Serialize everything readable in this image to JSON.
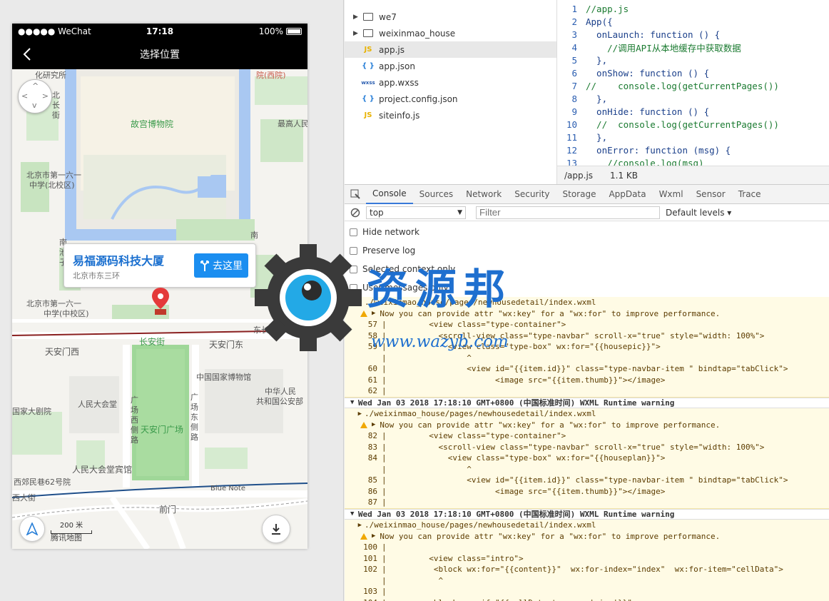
{
  "phone": {
    "carrier": "●●●●● WeChat",
    "time": "17:18",
    "battery": "100%",
    "nav_title": "选择位置"
  },
  "map": {
    "labels": {
      "research": "化研究所",
      "west_yuan": "院(西院)",
      "north_chang_1": "北",
      "north_chang_2": "长",
      "north_chang_3": "街",
      "palace": "故宫博物院",
      "supreme": "最高人民",
      "school1": "北京市第一六一",
      "school1b": "中学(北校区)",
      "nan1": "南",
      "nan2": "池",
      "nan2b": "子",
      "nan3": "南",
      "school2": "北京市第一六一",
      "school2b": "中学(中校区)",
      "east_chang": "东长安",
      "changan": "长安街",
      "tam_west": "天安门西",
      "tam_east": "天安门东",
      "museum": "中国国家博物馆",
      "guangchang_w1": "广",
      "guangchang_w2": "场",
      "guangchang_w3": "西",
      "guangchang_w4": "侧",
      "guangchang_w5": "路",
      "guangchang_e1": "广",
      "guangchang_e2": "场",
      "guangchang_e3": "东",
      "guangchang_e4": "侧",
      "guangchang_e5": "路",
      "people_hall": "人民大会堂",
      "security1": "中华人民",
      "security2": "共和国公安部",
      "theatre": "国家大剧院",
      "square": "天安门广场",
      "hall_hotel": "人民大会堂宾馆",
      "xijiao": "西郊民巷62号院",
      "blue_note": "Blue Note",
      "xidajie": "西大街",
      "qianmen": "前门",
      "scale": "200 米",
      "brand": "腾讯地图"
    },
    "popup": {
      "title": "易福源码科技大厦",
      "address": "北京市东三环",
      "go_label": "去这里"
    }
  },
  "file_tree": {
    "items": [
      {
        "name": "we7",
        "type": "folder"
      },
      {
        "name": "weixinmao_house",
        "type": "folder"
      },
      {
        "name": "app.js",
        "type": "js"
      },
      {
        "name": "app.json",
        "type": "json"
      },
      {
        "name": "app.wxss",
        "type": "wxss"
      },
      {
        "name": "project.config.json",
        "type": "json"
      },
      {
        "name": "siteinfo.js",
        "type": "js"
      }
    ]
  },
  "editor": {
    "lines": [
      "//app.js",
      "App({",
      "  onLaunch: function () {",
      "    //调用API从本地缓存中获取数据",
      "  },",
      "  onShow: function () {",
      "//    console.log(getCurrentPages())",
      "  },",
      "  onHide: function () {",
      "  //  console.log(getCurrentPages())",
      "  },",
      "  onError: function (msg) {",
      "    //console.log(msg)"
    ],
    "status_file": "/app.js",
    "status_size": "1.1 KB"
  },
  "devtools": {
    "tabs": [
      "Console",
      "Sources",
      "Network",
      "Security",
      "Storage",
      "AppData",
      "Wxml",
      "Sensor",
      "Trace"
    ],
    "context": "top",
    "filter_placeholder": "Filter",
    "levels": "Default levels",
    "options": [
      "Hide network",
      "Preserve log",
      "Selected context only",
      "User messages only"
    ]
  },
  "console": {
    "blocks": [
      {
        "header": "",
        "path": "./weixinmao_house/pages/newhousedetail/index.wxml",
        "message": "Now you can provide attr \"wx:key\" for a \"wx:for\" to improve performance.",
        "lines": [
          {
            "n": "57",
            "code": "        <view class=\"type-container\">"
          },
          {
            "n": "58",
            "code": "          <scroll-view class=\"type-navbar\" scroll-x=\"true\" style=\"width: 100%\">"
          },
          {
            "n": "59",
            "code": "            <view class=\"type-box\" wx:for=\"{{housepic}}\">",
            "mark": ">"
          },
          {
            "n": "",
            "code": "                ^"
          },
          {
            "n": "60",
            "code": "                <view id=\"{{item.id}}\" class=\"type-navbar-item \" bindtap=\"tabClick\">"
          },
          {
            "n": "61",
            "code": "                      <image src=\"{{item.thumb}}\"></image>"
          },
          {
            "n": "62",
            "code": ""
          }
        ]
      },
      {
        "header": "Wed Jan 03 2018 17:18:10 GMT+0800 (中国标准时间) WXML Runtime warning",
        "path": "./weixinmao_house/pages/newhousedetail/index.wxml",
        "message": "Now you can provide attr \"wx:key\" for a \"wx:for\" to improve performance.",
        "lines": [
          {
            "n": "82",
            "code": "        <view class=\"type-container\">"
          },
          {
            "n": "83",
            "code": "          <scroll-view class=\"type-navbar\" scroll-x=\"true\" style=\"width: 100%\">"
          },
          {
            "n": "84",
            "code": "            <view class=\"type-box\" wx:for=\"{{houseplan}}\">",
            "mark": ">"
          },
          {
            "n": "",
            "code": "                ^"
          },
          {
            "n": "85",
            "code": "                <view id=\"{{item.id}}\" class=\"type-navbar-item \" bindtap=\"tabClick\">"
          },
          {
            "n": "86",
            "code": "                      <image src=\"{{item.thumb}}\"></image>"
          },
          {
            "n": "87",
            "code": ""
          }
        ]
      },
      {
        "header": "Wed Jan 03 2018 17:18:10 GMT+0800 (中国标准时间) WXML Runtime warning",
        "path": "./weixinmao_house/pages/newhousedetail/index.wxml",
        "message": "Now you can provide attr \"wx:key\" for a \"wx:for\" to improve performance.",
        "lines": [
          {
            "n": "100",
            "code": ""
          },
          {
            "n": "101",
            "code": "        <view class=\"intro\">"
          },
          {
            "n": "102",
            "code": "         <block wx:for=\"{{content}}\"  wx:for-index=\"index\"  wx:for-item=\"cellData\">",
            "mark": ">"
          },
          {
            "n": "",
            "code": "          ^"
          },
          {
            "n": "103",
            "code": ""
          },
          {
            "n": "104",
            "code": "        <block  wx:if=\"{{cellData.type == 'view'}}\">"
          }
        ]
      }
    ]
  },
  "watermark": {
    "text": "资源邦",
    "url": "www.wazyb.com"
  },
  "colors": {
    "accent": "#1b8ef0",
    "warning_bg": "#fffbe5",
    "map_green": "#a9dca0",
    "map_water": "#a9c8f2"
  }
}
